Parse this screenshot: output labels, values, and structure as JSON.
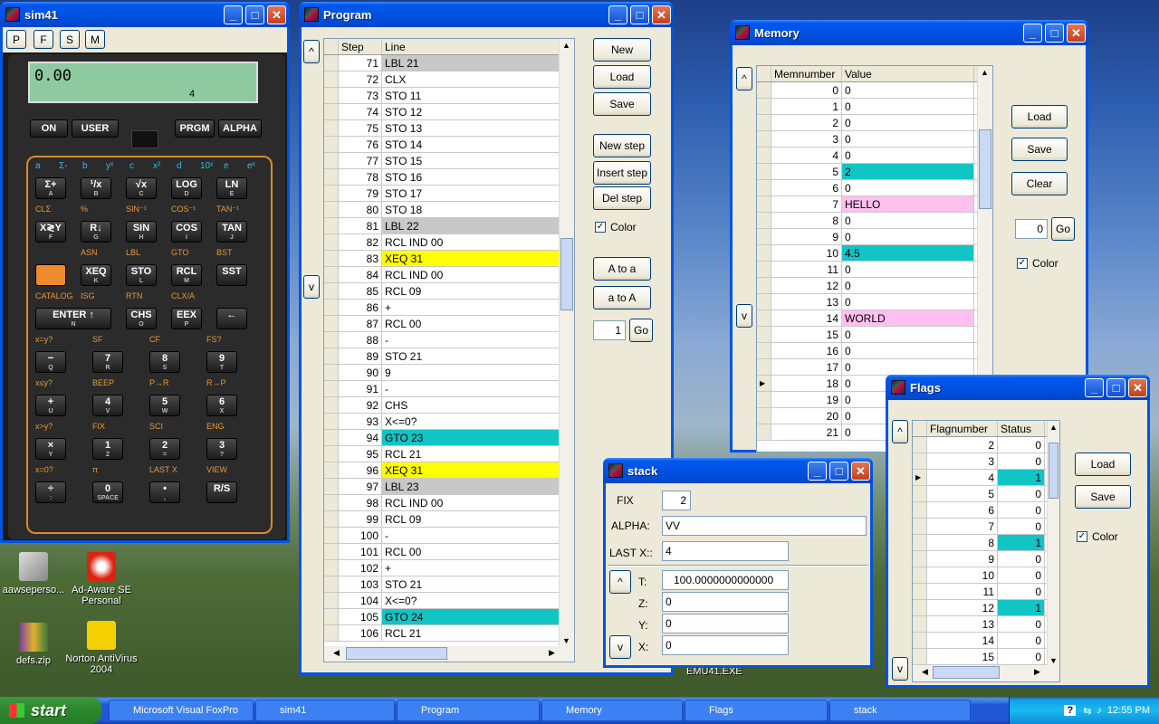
{
  "desktop": {
    "icons": [
      {
        "label": "aawsepersonal.exe",
        "display": "aawseperso..."
      },
      {
        "label": "Ad-Aware SE Personal"
      },
      {
        "label": "defs.zip"
      },
      {
        "label": "Norton AntiVirus 2004"
      }
    ],
    "emu_label": "EMU41.EXE"
  },
  "sim41": {
    "title": "sim41",
    "menu": [
      "P",
      "F",
      "S",
      "M"
    ],
    "display_value": "0.00",
    "display_annun": "4",
    "top_buttons": [
      "ON",
      "USER",
      "PRGM",
      "ALPHA"
    ],
    "row_letters": [
      "a",
      "Σ-",
      "b",
      "yˣ",
      "c",
      "x²",
      "d",
      "10ˣ",
      "e",
      "eˣ"
    ],
    "rows": [
      {
        "keys": [
          {
            "l": "Σ+",
            "s": "A"
          },
          {
            "l": "¹/x",
            "s": "B"
          },
          {
            "l": "√x",
            "s": "C"
          },
          {
            "l": "LOG",
            "s": "D"
          },
          {
            "l": "LN",
            "s": "E"
          }
        ],
        "shift": [
          "CLΣ",
          "%",
          "SIN⁻¹",
          "COS⁻¹",
          "TAN⁻¹"
        ]
      },
      {
        "keys": [
          {
            "l": "X≷Y",
            "s": "F"
          },
          {
            "l": "R↓",
            "s": "G"
          },
          {
            "l": "SIN",
            "s": "H"
          },
          {
            "l": "COS",
            "s": "I"
          },
          {
            "l": "TAN",
            "s": "J"
          }
        ],
        "shift": [
          "",
          "ASN",
          "LBL",
          "GTO",
          "BST"
        ]
      },
      {
        "keys": [
          {
            "l": "",
            "s": ""
          },
          {
            "l": "XEQ",
            "s": "K"
          },
          {
            "l": "STO",
            "s": "L"
          },
          {
            "l": "RCL",
            "s": "M"
          },
          {
            "l": "SST",
            "s": ""
          }
        ],
        "shift": [
          "CATALOG",
          "ISG",
          "RTN",
          "CLX/A",
          ""
        ]
      },
      {
        "keys": [
          {
            "l": "ENTER ↑",
            "s": "N"
          },
          {
            "l": "CHS",
            "s": "O"
          },
          {
            "l": "EEX",
            "s": "P"
          },
          {
            "l": "←",
            "s": ""
          }
        ],
        "shift": [
          "x=y?",
          "SF",
          "CF",
          "FS?",
          ""
        ]
      },
      {
        "keys": [
          {
            "l": "−",
            "s": "Q"
          },
          {
            "l": "7",
            "s": "R"
          },
          {
            "l": "8",
            "s": "S"
          },
          {
            "l": "9",
            "s": "T"
          }
        ],
        "shift": [
          "x≤y?",
          "BEEP",
          "P→R",
          "R→P",
          ""
        ]
      },
      {
        "keys": [
          {
            "l": "+",
            "s": "U"
          },
          {
            "l": "4",
            "s": "V"
          },
          {
            "l": "5",
            "s": "W"
          },
          {
            "l": "6",
            "s": "X"
          }
        ],
        "shift": [
          "x>y?",
          "FIX",
          "SCI",
          "ENG",
          ""
        ]
      },
      {
        "keys": [
          {
            "l": "×",
            "s": "Y"
          },
          {
            "l": "1",
            "s": "Z"
          },
          {
            "l": "2",
            "s": "="
          },
          {
            "l": "3",
            "s": "?"
          }
        ],
        "shift": [
          "x=0?",
          "π",
          "LAST X",
          "VIEW",
          ""
        ]
      },
      {
        "keys": [
          {
            "l": "÷",
            "s": ":"
          },
          {
            "l": "0",
            "s": "SPACE"
          },
          {
            "l": "•",
            "s": ","
          },
          {
            "l": "R/S",
            "s": ""
          }
        ],
        "shift": []
      }
    ]
  },
  "program": {
    "title": "Program",
    "headers": [
      "Step",
      "Line"
    ],
    "rows": [
      {
        "step": "71",
        "line": "LBL 21",
        "hl": "gray"
      },
      {
        "step": "72",
        "line": "CLX",
        "hl": ""
      },
      {
        "step": "73",
        "line": "STO 11",
        "hl": ""
      },
      {
        "step": "74",
        "line": "STO 12",
        "hl": ""
      },
      {
        "step": "75",
        "line": "STO 13",
        "hl": ""
      },
      {
        "step": "76",
        "line": "STO 14",
        "hl": ""
      },
      {
        "step": "77",
        "line": "STO 15",
        "hl": ""
      },
      {
        "step": "78",
        "line": "STO 16",
        "hl": ""
      },
      {
        "step": "79",
        "line": "STO 17",
        "hl": ""
      },
      {
        "step": "80",
        "line": "STO 18",
        "hl": ""
      },
      {
        "step": "81",
        "line": "LBL 22",
        "hl": "gray"
      },
      {
        "step": "82",
        "line": "RCL IND 00",
        "hl": ""
      },
      {
        "step": "83",
        "line": "XEQ 31",
        "hl": "yellow"
      },
      {
        "step": "84",
        "line": "RCL IND 00",
        "hl": ""
      },
      {
        "step": "85",
        "line": "RCL 09",
        "hl": ""
      },
      {
        "step": "86",
        "line": "+",
        "hl": ""
      },
      {
        "step": "87",
        "line": "RCL 00",
        "hl": ""
      },
      {
        "step": "88",
        "line": "-",
        "hl": ""
      },
      {
        "step": "89",
        "line": "STO 21",
        "hl": ""
      },
      {
        "step": "90",
        "line": "9",
        "hl": ""
      },
      {
        "step": "91",
        "line": "-",
        "hl": ""
      },
      {
        "step": "92",
        "line": "CHS",
        "hl": ""
      },
      {
        "step": "93",
        "line": "X<=0?",
        "hl": ""
      },
      {
        "step": "94",
        "line": "GTO 23",
        "hl": "cyan"
      },
      {
        "step": "95",
        "line": "RCL 21",
        "hl": ""
      },
      {
        "step": "96",
        "line": "XEQ 31",
        "hl": "yellow"
      },
      {
        "step": "97",
        "line": "LBL 23",
        "hl": "gray"
      },
      {
        "step": "98",
        "line": "RCL IND 00",
        "hl": ""
      },
      {
        "step": "99",
        "line": "RCL 09",
        "hl": ""
      },
      {
        "step": "100",
        "line": "-",
        "hl": ""
      },
      {
        "step": "101",
        "line": "RCL 00",
        "hl": ""
      },
      {
        "step": "102",
        "line": "+",
        "hl": ""
      },
      {
        "step": "103",
        "line": "STO 21",
        "hl": ""
      },
      {
        "step": "104",
        "line": "X<=0?",
        "hl": ""
      },
      {
        "step": "105",
        "line": "GTO 24",
        "hl": "cyan"
      },
      {
        "step": "106",
        "line": "RCL 21",
        "hl": ""
      }
    ],
    "buttons": {
      "new": "New",
      "load": "Load",
      "save": "Save",
      "new_step": "New step",
      "insert_step": "Insert step",
      "del_step": "Del step",
      "a_to_A": "A to a",
      "A_to_a": "a to A",
      "go": "Go"
    },
    "color_label": "Color",
    "goto_value": "1",
    "nav_up": "^",
    "nav_down": "v"
  },
  "memory": {
    "title": "Memory",
    "headers": [
      "Memnumber",
      "Value"
    ],
    "rows": [
      {
        "n": "0",
        "v": "0",
        "hl": ""
      },
      {
        "n": "1",
        "v": "0",
        "hl": ""
      },
      {
        "n": "2",
        "v": "0",
        "hl": ""
      },
      {
        "n": "3",
        "v": "0",
        "hl": ""
      },
      {
        "n": "4",
        "v": "0",
        "hl": ""
      },
      {
        "n": "5",
        "v": "2",
        "hl": "cyan"
      },
      {
        "n": "6",
        "v": "0",
        "hl": ""
      },
      {
        "n": "7",
        "v": "HELLO",
        "hl": "pink"
      },
      {
        "n": "8",
        "v": "0",
        "hl": ""
      },
      {
        "n": "9",
        "v": "0",
        "hl": ""
      },
      {
        "n": "10",
        "v": "4.5",
        "hl": "cyan"
      },
      {
        "n": "11",
        "v": "0",
        "hl": ""
      },
      {
        "n": "12",
        "v": "0",
        "hl": ""
      },
      {
        "n": "13",
        "v": "0",
        "hl": ""
      },
      {
        "n": "14",
        "v": "WORLD",
        "hl": "pink"
      },
      {
        "n": "15",
        "v": "0",
        "hl": ""
      },
      {
        "n": "16",
        "v": "0",
        "hl": ""
      },
      {
        "n": "17",
        "v": "0",
        "hl": ""
      },
      {
        "n": "18",
        "v": "0",
        "hl": ""
      },
      {
        "n": "19",
        "v": "0",
        "hl": ""
      },
      {
        "n": "20",
        "v": "0",
        "hl": ""
      },
      {
        "n": "21",
        "v": "0",
        "hl": ""
      }
    ],
    "buttons": {
      "load": "Load",
      "save": "Save",
      "clear": "Clear",
      "go": "Go"
    },
    "goto_value": "0",
    "color_label": "Color"
  },
  "flags": {
    "title": "Flags",
    "headers": [
      "Flagnumber",
      "Status"
    ],
    "rows": [
      {
        "n": "2",
        "s": "0",
        "hl": ""
      },
      {
        "n": "3",
        "s": "0",
        "hl": ""
      },
      {
        "n": "4",
        "s": "1",
        "hl": "cyan"
      },
      {
        "n": "5",
        "s": "0",
        "hl": ""
      },
      {
        "n": "6",
        "s": "0",
        "hl": ""
      },
      {
        "n": "7",
        "s": "0",
        "hl": ""
      },
      {
        "n": "8",
        "s": "1",
        "hl": "cyan"
      },
      {
        "n": "9",
        "s": "0",
        "hl": ""
      },
      {
        "n": "10",
        "s": "0",
        "hl": ""
      },
      {
        "n": "11",
        "s": "0",
        "hl": ""
      },
      {
        "n": "12",
        "s": "1",
        "hl": "cyan"
      },
      {
        "n": "13",
        "s": "0",
        "hl": ""
      },
      {
        "n": "14",
        "s": "0",
        "hl": ""
      },
      {
        "n": "15",
        "s": "0",
        "hl": ""
      }
    ],
    "buttons": {
      "load": "Load",
      "save": "Save"
    },
    "color_label": "Color"
  },
  "stack": {
    "title": "stack",
    "fix_label": "FIX",
    "fix_value": "2",
    "alpha_label": "ALPHA:",
    "alpha_value": "VV",
    "lastx_label": "LAST X::",
    "lastx_value": "4",
    "t_label": "T:",
    "t_value": "100.0000000000000",
    "z_label": "Z:",
    "z_value": "0",
    "y_label": "Y:",
    "y_value": "0",
    "x_label": "X:",
    "x_value": "0"
  },
  "taskbar": {
    "start": "start",
    "items": [
      "Microsoft Visual FoxPro",
      "sim41",
      "Program",
      "Memory",
      "Flags",
      "stack"
    ],
    "clock": "12:55 PM"
  },
  "colors": {
    "gray": "#c8c8c8",
    "yellow": "#ffff00",
    "cyan": "#11c5c5",
    "pink": "#ffc0f0",
    "lcd": "#8fc9a0"
  }
}
